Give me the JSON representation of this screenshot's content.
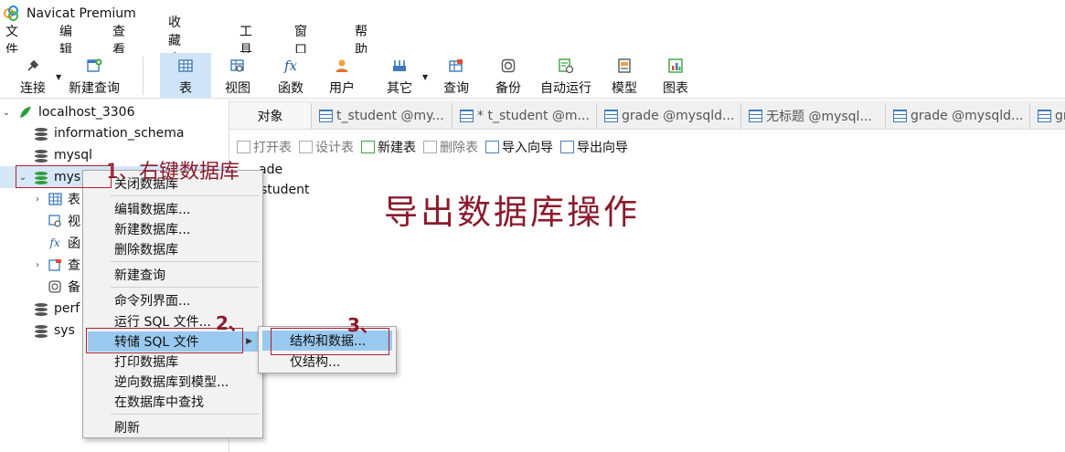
{
  "window": {
    "title": "Navicat Premium"
  },
  "menubar": [
    "文件",
    "编辑",
    "查看",
    "收藏夹",
    "工具",
    "窗口",
    "帮助"
  ],
  "toolbar": {
    "buttons": [
      {
        "label": "连接",
        "icon": "plug-icon"
      },
      {
        "label": "新建查询",
        "icon": "new-query-icon"
      },
      {
        "label": "表",
        "icon": "table-icon",
        "active": true
      },
      {
        "label": "视图",
        "icon": "view-icon"
      },
      {
        "label": "函数",
        "icon": "function-icon",
        "glyph": "fx"
      },
      {
        "label": "用户",
        "icon": "user-icon"
      },
      {
        "label": "其它",
        "icon": "other-icon"
      },
      {
        "label": "查询",
        "icon": "query-icon"
      },
      {
        "label": "备份",
        "icon": "backup-icon"
      },
      {
        "label": "自动运行",
        "icon": "auto-run-icon"
      },
      {
        "label": "模型",
        "icon": "model-icon"
      },
      {
        "label": "图表",
        "icon": "chart-icon"
      }
    ]
  },
  "sidebar": {
    "connection": "localhost_3306",
    "databases": [
      "information_schema",
      "mysql",
      "mys",
      "perf",
      "sys"
    ],
    "children": [
      "表",
      "视",
      "函",
      "查",
      "备"
    ],
    "child_glyphs": {
      "function": "fx"
    }
  },
  "tabs": [
    {
      "label": "对象"
    },
    {
      "label": "t_student @my..."
    },
    {
      "label": "* t_student @m..."
    },
    {
      "label": "grade @mysqld..."
    },
    {
      "label": "无标题 @mysql..."
    },
    {
      "label": "grade @mysqld..."
    },
    {
      "label": "gr"
    }
  ],
  "object_toolbar": [
    {
      "label": "打开表",
      "enabled": false
    },
    {
      "label": "设计表",
      "enabled": false
    },
    {
      "label": "新建表",
      "enabled": true
    },
    {
      "label": "删除表",
      "enabled": false
    },
    {
      "label": "导入向导",
      "enabled": true
    },
    {
      "label": "导出向导",
      "enabled": true
    }
  ],
  "tables": [
    "ade",
    "student"
  ],
  "caption": "导出数据库操作",
  "context_menu": {
    "items": [
      "关闭数据库",
      "编辑数据库...",
      "新建数据库...",
      "删除数据库",
      "新建查询",
      "命令列界面...",
      "运行 SQL 文件...",
      "转储 SQL 文件",
      "打印数据库",
      "逆向数据库到模型...",
      "在数据库中查找",
      "刷新"
    ],
    "highlighted": "转储 SQL 文件"
  },
  "submenu": {
    "items": [
      "结构和数据...",
      "仅结构..."
    ],
    "highlighted": "结构和数据..."
  },
  "annotations": {
    "step1": "1、右键数据库",
    "step2": "2、",
    "step3": "3、"
  },
  "colors": {
    "annotation": "#8b1a2b",
    "highlight": "#99c9ef",
    "selection": "#d6e7f8",
    "db_green": "#2e9e3e",
    "db_gray": "#555555"
  }
}
